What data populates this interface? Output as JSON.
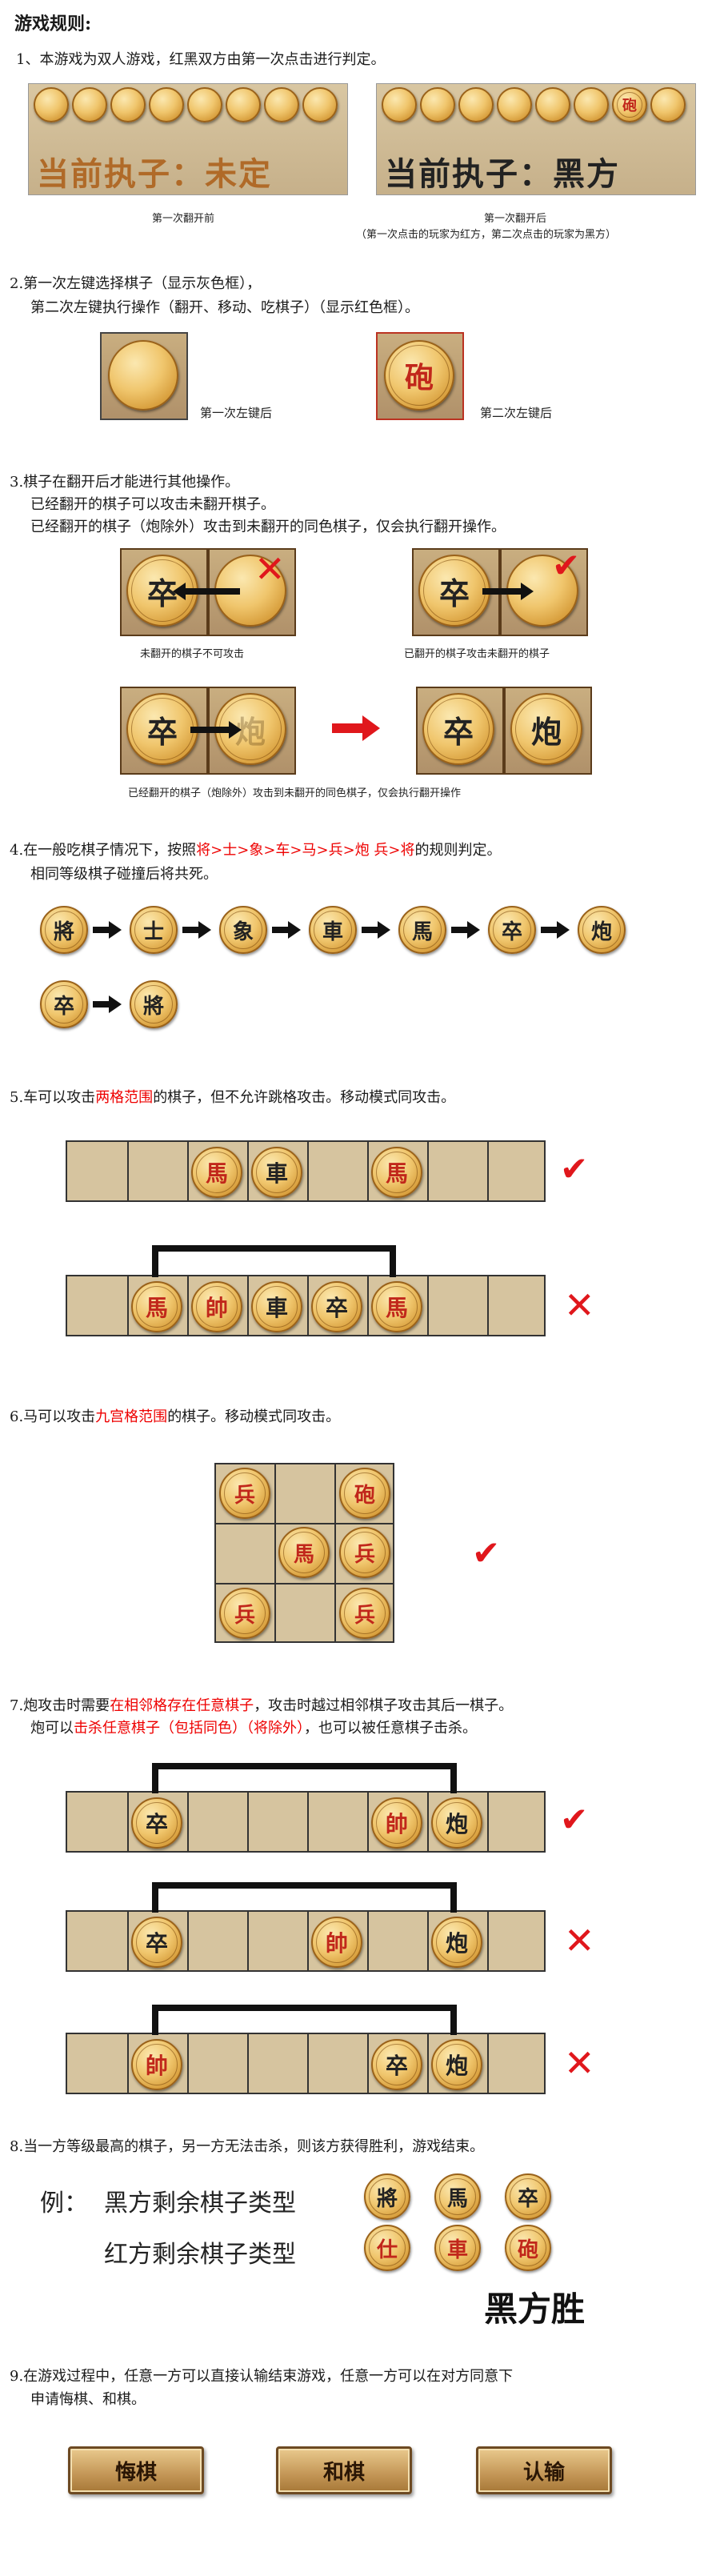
{
  "title": "游戏规则:",
  "s1": {
    "text": "1、本游戏为双人游戏，红黑双方由第一次点击进行判定。",
    "left_status": "当前执子：未定",
    "right_status": "当前执子：黑方",
    "cap_left": "第一次翻开前",
    "cap_right": "第一次翻开后",
    "cap_right2": "（第一次点击的玩家为红方，第二次点击的玩家为黑方）",
    "right_piece": "砲"
  },
  "s2": {
    "line1": "2.第一次左键选择棋子（显示灰色框），",
    "line2": "第二次左键执行操作（翻开、移动、吃棋子）（显示红色框）。",
    "cap1": "第一次左键后",
    "cap2": "第二次左键后",
    "piece": "砲"
  },
  "s3": {
    "line1": "3.棋子在翻开后才能进行其他操作。",
    "line2": "已经翻开的棋子可以攻击未翻开棋子。",
    "line3": "已经翻开的棋子（炮除外）攻击到未翻开的同色棋子，仅会执行翻开操作。",
    "cap1": "未翻开的棋子不可攻击",
    "cap2": "已翻开的棋子攻击未翻开的棋子",
    "cap3": "已经翻开的棋子（炮除外）攻击到未翻开的同色棋子，仅会执行翻开操作",
    "p_zu": "卒",
    "p_pao": "炮"
  },
  "s4": {
    "line1a": "4.在一般吃棋子情况下，按照",
    "line1b": "将>士>象>车>马>兵>炮 兵>将",
    "line1c": "的规则判定。",
    "line2": "相同等级棋子碰撞后将共死。",
    "chain": [
      "將",
      "士",
      "象",
      "車",
      "馬",
      "卒",
      "炮"
    ],
    "chain2": [
      "卒",
      "將"
    ]
  },
  "s5": {
    "a": "5.车可以攻击",
    "b": "两格范围",
    "c": "的棋子，但不允许跳格攻击。移动模式同攻击。",
    "row1": [
      "馬",
      "車",
      "馬"
    ],
    "row2": [
      "馬",
      "帥",
      "車",
      "卒",
      "馬"
    ]
  },
  "s6": {
    "a": "6.马可以攻击",
    "b": "九宫格范围",
    "c": "的棋子。移动模式同攻击。",
    "grid": [
      "兵",
      "砲",
      "馬",
      "兵",
      "兵",
      "兵"
    ]
  },
  "s7": {
    "l1a": "7.炮攻击时需要",
    "l1b": "在相邻格存在任意棋子",
    "l1c": "，攻击时越过相邻棋子攻击其后一棋子。",
    "l2a": "炮可以",
    "l2b": "击杀任意棋子（包括同色）（将除外）",
    "l2c": "，也可以被任意棋子击杀。",
    "row1": [
      "卒",
      "帥",
      "炮"
    ],
    "row2": [
      "卒",
      "帥",
      "炮"
    ],
    "row3": [
      "帥",
      "卒",
      "炮"
    ]
  },
  "s8": {
    "text": "8.当一方等级最高的棋子，另一方无法击杀，则该方获得胜利，游戏结束。",
    "ex": "例：",
    "black": "黑方剩余棋子类型",
    "red": "红方剩余棋子类型",
    "black_pieces": [
      "將",
      "馬",
      "卒"
    ],
    "red_pieces": [
      "仕",
      "車",
      "砲"
    ],
    "result": "黑方胜"
  },
  "s9": {
    "line1": "9.在游戏过程中，任意一方可以直接认输结束游戏，任意一方可以在对方同意下",
    "line2": "申请悔棋、和棋。"
  },
  "buttons": [
    "悔棋",
    "和棋",
    "认输"
  ]
}
